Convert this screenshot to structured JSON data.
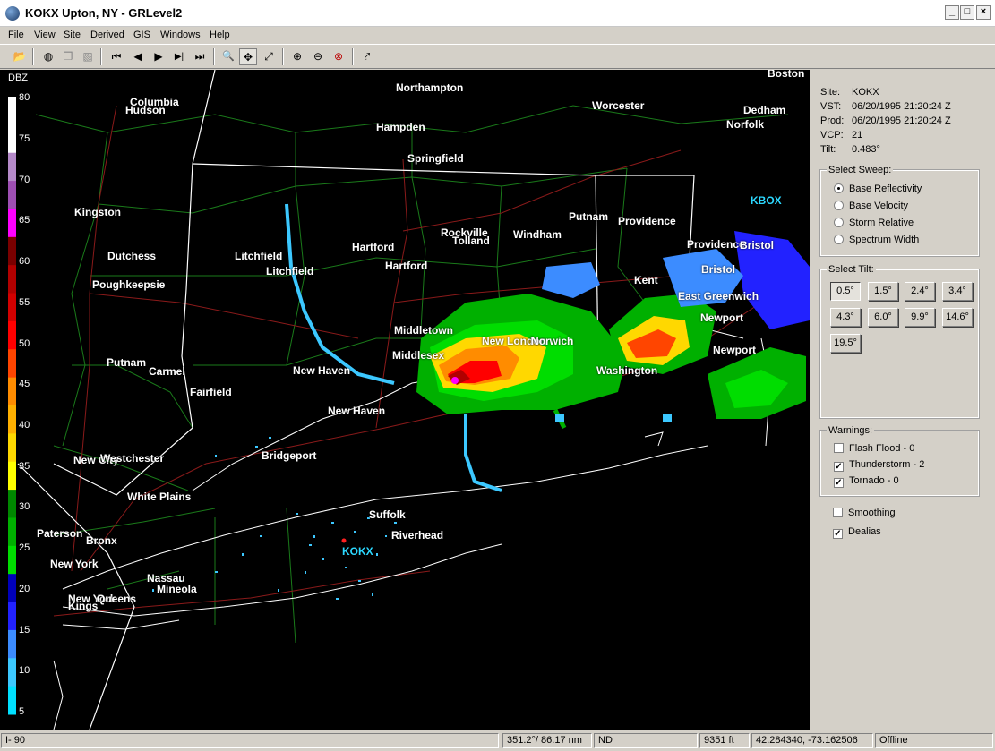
{
  "window": {
    "title": "KOKX Upton, NY - GRLevel2",
    "minimize": "_",
    "maximize": "□",
    "close": "×"
  },
  "menu": [
    "File",
    "View",
    "Site",
    "Derived",
    "GIS",
    "Windows",
    "Help"
  ],
  "toolbar": {
    "icons": [
      "open-folder-icon",
      "globe-icon",
      "copy-icon",
      "print-icon",
      "first-frame-icon",
      "previous-frame-icon",
      "play-icon",
      "next-frame-icon",
      "last-frame-icon",
      "zoom-icon",
      "pan-icon",
      "measure-icon",
      "zoom-in-icon",
      "zoom-out-icon",
      "zoom-reset-icon",
      "probe-icon"
    ],
    "glyphs": [
      "📂",
      "◍",
      "❐",
      "▧",
      "⏮",
      "◀",
      "▶",
      "▶|",
      "⏭",
      "🔍",
      "✥",
      "⤢",
      "⊕",
      "⊖",
      "⊗",
      "⤤"
    ]
  },
  "scale": {
    "title": "DBZ",
    "labels": [
      "80",
      "75",
      "70",
      "65",
      "60",
      "55",
      "50",
      "45",
      "40",
      "35",
      "30",
      "25",
      "20",
      "15",
      "10",
      "5"
    ],
    "colors": [
      "#ffffff",
      "#ffffff",
      "#b58ac9",
      "#9e4fb3",
      "#ff00ff",
      "#7a0000",
      "#b10000",
      "#d20000",
      "#ff0000",
      "#ff4500",
      "#ff8c00",
      "#ffb000",
      "#ffd800",
      "#ffff00",
      "#008800",
      "#00b000",
      "#00dd00",
      "#0000bb",
      "#2222ff",
      "#3c8cff",
      "#3cc8ff",
      "#00e0ff"
    ]
  },
  "map": {
    "places": [
      {
        "name": "Boston",
        "cyan": false
      },
      {
        "name": "Columbia",
        "cyan": false
      },
      {
        "name": "Hudson",
        "cyan": false
      },
      {
        "name": "Northampton",
        "cyan": false
      },
      {
        "name": "Worcester",
        "cyan": false
      },
      {
        "name": "Dedham",
        "cyan": false
      },
      {
        "name": "Norfolk",
        "cyan": false
      },
      {
        "name": "Hampden",
        "cyan": false
      },
      {
        "name": "Springfield",
        "cyan": false
      },
      {
        "name": "KBOX",
        "cyan": true
      },
      {
        "name": "Kingston",
        "cyan": false
      },
      {
        "name": "Putnam",
        "cyan": false
      },
      {
        "name": "Providence",
        "cyan": false
      },
      {
        "name": "Rockville",
        "cyan": false
      },
      {
        "name": "Tolland",
        "cyan": false
      },
      {
        "name": "Windham",
        "cyan": false
      },
      {
        "name": "Providence",
        "cyan": false
      },
      {
        "name": "Bristol",
        "cyan": false
      },
      {
        "name": "Dutchess",
        "cyan": false
      },
      {
        "name": "Litchfield",
        "cyan": false
      },
      {
        "name": "Hartford",
        "cyan": false
      },
      {
        "name": "Hartford",
        "cyan": false
      },
      {
        "name": "Bristol",
        "cyan": false
      },
      {
        "name": "Litchfield",
        "cyan": false
      },
      {
        "name": "Poughkeepsie",
        "cyan": false
      },
      {
        "name": "Kent",
        "cyan": false
      },
      {
        "name": "East Greenwich",
        "cyan": false
      },
      {
        "name": "Newport",
        "cyan": false
      },
      {
        "name": "Middletown",
        "cyan": false
      },
      {
        "name": "New London",
        "cyan": false
      },
      {
        "name": "Norwich",
        "cyan": false
      },
      {
        "name": "Newport",
        "cyan": false
      },
      {
        "name": "Middlesex",
        "cyan": false
      },
      {
        "name": "Putnam",
        "cyan": false
      },
      {
        "name": "Carmel",
        "cyan": false
      },
      {
        "name": "New Haven",
        "cyan": false
      },
      {
        "name": "Washington",
        "cyan": false
      },
      {
        "name": "Fairfield",
        "cyan": false
      },
      {
        "name": "New Haven",
        "cyan": false
      },
      {
        "name": "Bridgeport",
        "cyan": false
      },
      {
        "name": "New City",
        "cyan": false
      },
      {
        "name": "Westchester",
        "cyan": false
      },
      {
        "name": "White Plains",
        "cyan": false
      },
      {
        "name": "Suffolk",
        "cyan": false
      },
      {
        "name": "Paterson",
        "cyan": false
      },
      {
        "name": "Riverhead",
        "cyan": false
      },
      {
        "name": "Bronx",
        "cyan": false
      },
      {
        "name": "KOKX",
        "cyan": true
      },
      {
        "name": "New York",
        "cyan": false
      },
      {
        "name": "Nassau",
        "cyan": false
      },
      {
        "name": "Mineola",
        "cyan": false
      },
      {
        "name": "New York",
        "cyan": false
      },
      {
        "name": "Queens",
        "cyan": false
      },
      {
        "name": "Kings",
        "cyan": false
      }
    ]
  },
  "info": {
    "site": {
      "key": "Site:",
      "value": "KOKX"
    },
    "vst": {
      "key": "VST:",
      "value": "06/20/1995  21:20:24 Z"
    },
    "prod": {
      "key": "Prod:",
      "value": "06/20/1995  21:20:24 Z"
    },
    "vcp": {
      "key": "VCP:",
      "value": "21"
    },
    "tilt": {
      "key": "Tilt:",
      "value": "0.483°"
    }
  },
  "sweep": {
    "title": "Select Sweep:",
    "options": [
      {
        "label": "Base Reflectivity",
        "selected": true
      },
      {
        "label": "Base Velocity",
        "selected": false
      },
      {
        "label": "Storm Relative",
        "selected": false
      },
      {
        "label": "Spectrum Width",
        "selected": false
      }
    ]
  },
  "tilt_select": {
    "title": "Select Tilt:",
    "buttons": [
      {
        "label": "0.5°",
        "pressed": true
      },
      {
        "label": "1.5°",
        "pressed": false
      },
      {
        "label": "2.4°",
        "pressed": false
      },
      {
        "label": "3.4°",
        "pressed": false
      },
      {
        "label": "4.3°",
        "pressed": false
      },
      {
        "label": "6.0°",
        "pressed": false
      },
      {
        "label": "9.9°",
        "pressed": false
      },
      {
        "label": "14.6°",
        "pressed": false
      },
      {
        "label": "19.5°",
        "pressed": false
      }
    ]
  },
  "warnings": {
    "title": "Warnings:",
    "items": [
      {
        "label": "Flash Flood - 0",
        "checked": false
      },
      {
        "label": "Thunderstorm - 2",
        "checked": true
      },
      {
        "label": "Tornado - 0",
        "checked": true
      }
    ]
  },
  "options": [
    {
      "label": "Smoothing",
      "checked": false
    },
    {
      "label": "Dealias",
      "checked": true
    }
  ],
  "status": {
    "left": "I- 90",
    "azimuth": "351.2°/ 86.17 nm",
    "value": "ND",
    "height": "9351 ft",
    "coords": "42.284340, -73.162506",
    "connection": "Offline"
  }
}
